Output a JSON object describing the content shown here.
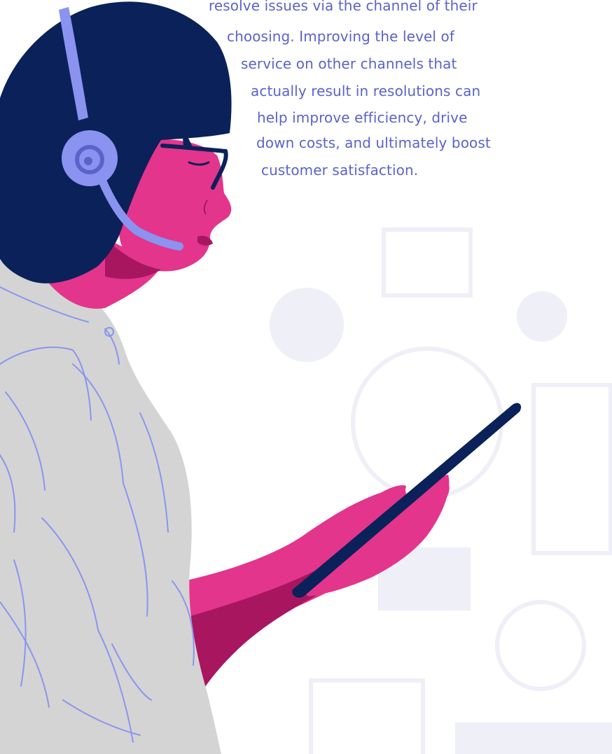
{
  "body_text": {
    "lines": [
      "resolve issues via the channel of their",
      "choosing. Improving the level of",
      "service on other channels that",
      "actually result in resolutions can",
      "help improve efficiency, drive",
      "down costs, and ultimately boost",
      "customer satisfaction."
    ]
  },
  "colors": {
    "text": "#5b63c9",
    "hair": "#0b2159",
    "skin": "#e3358c",
    "skin_shadow": "#a81660",
    "headset": "#8b93f0",
    "shirt": "#d4d4d4",
    "shirt_lines": "#8a95ef",
    "tablet": "#0b2159",
    "decor": "#eeeff7"
  },
  "illustration": {
    "subject": "woman-with-headset-holding-tablet"
  }
}
